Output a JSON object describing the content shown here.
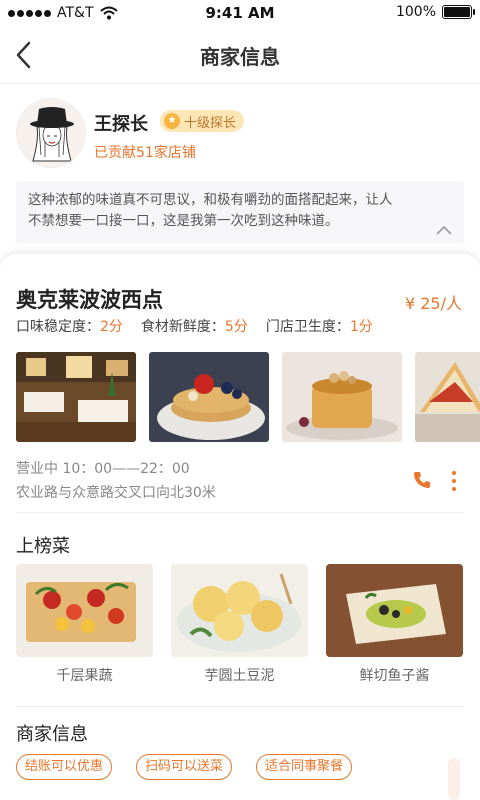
{
  "status_bar": {
    "carrier": "AT&T",
    "time": "9:41 AM",
    "battery": "100%",
    "battery_level": 1.0
  },
  "nav": {
    "title": "商家信息",
    "back_icon": "chevron-left-icon"
  },
  "profile": {
    "name": "王探长",
    "badge": "十级探长",
    "contribution": "已贡献51家店铺"
  },
  "review": {
    "line1": "这种浓郁的味道真不可思议，和极有嚼劲的面搭配起来，让人",
    "line2": "不禁想要一口接一口，这是我第一次吃到这种味道。"
  },
  "shop": {
    "name": "奥克莱波波西点",
    "price": "¥ 25/人",
    "ratings": [
      {
        "label": "口味稳定度：",
        "value": "2分"
      },
      {
        "label": "食材新鲜度：",
        "value": "5分"
      },
      {
        "label": "门店卫生度：",
        "value": "1分"
      }
    ],
    "hours": "营业中  10：00——22：00",
    "address": "农业路与众意路交叉口向北30米"
  },
  "dishes_section": {
    "title": "上榜菜",
    "items": [
      {
        "name": "千层果蔬"
      },
      {
        "name": "芋圆土豆泥"
      },
      {
        "name": "鲜切鱼子酱"
      }
    ]
  },
  "merchant_section": {
    "title": "商家信息",
    "tags": [
      "结账可以优惠",
      "扫码可以送菜",
      "适合同事聚餐"
    ]
  },
  "colors": {
    "accent": "#e8762c",
    "badge_bg": "#fde6b6"
  }
}
